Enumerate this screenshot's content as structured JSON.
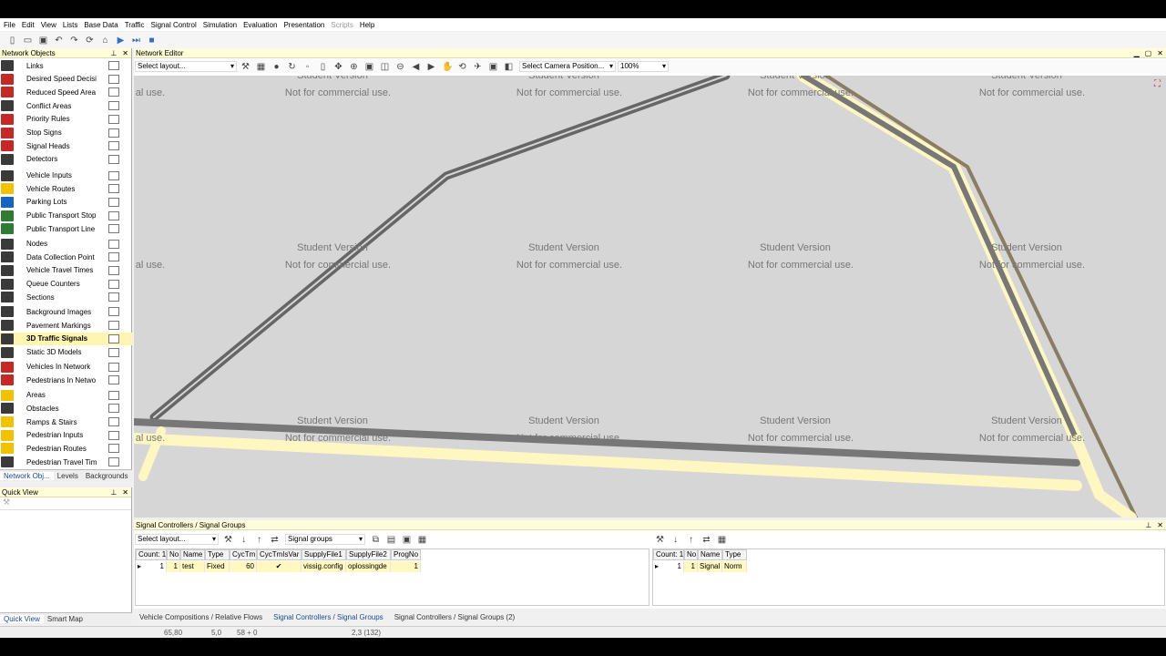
{
  "menu": [
    "File",
    "Edit",
    "View",
    "Lists",
    "Base Data",
    "Traffic",
    "Signal Control",
    "Simulation",
    "Evaluation",
    "Presentation",
    "Scripts",
    "Help"
  ],
  "network_objects": {
    "title": "Network Objects",
    "items": [
      {
        "label": "Links",
        "icon": "link-icon"
      },
      {
        "label": "Desired Speed Decisi",
        "icon": "speed-icon"
      },
      {
        "label": "Reduced Speed Area",
        "icon": "reduced-speed-icon"
      },
      {
        "label": "Conflict Areas",
        "icon": "conflict-icon"
      },
      {
        "label": "Priority Rules",
        "icon": "priority-icon"
      },
      {
        "label": "Stop Signs",
        "icon": "stop-icon"
      },
      {
        "label": "Signal Heads",
        "icon": "signal-head-icon"
      },
      {
        "label": "Detectors",
        "icon": "detector-icon"
      },
      {
        "label": "Vehicle Inputs",
        "icon": "vehicle-input-icon"
      },
      {
        "label": "Vehicle Routes",
        "icon": "route-icon"
      },
      {
        "label": "Parking Lots",
        "icon": "parking-icon"
      },
      {
        "label": "Public Transport Stop",
        "icon": "pt-stop-icon"
      },
      {
        "label": "Public Transport Line",
        "icon": "pt-line-icon"
      },
      {
        "label": "Nodes",
        "icon": "node-icon"
      },
      {
        "label": "Data Collection Point",
        "icon": "data-point-icon"
      },
      {
        "label": "Vehicle Travel Times",
        "icon": "travel-time-icon"
      },
      {
        "label": "Queue Counters",
        "icon": "queue-icon"
      },
      {
        "label": "Sections",
        "icon": "section-icon"
      },
      {
        "label": "Background Images",
        "icon": "image-icon"
      },
      {
        "label": "Pavement Markings",
        "icon": "marking-icon"
      },
      {
        "label": "3D Traffic Signals",
        "icon": "traffic-signal-3d-icon"
      },
      {
        "label": "Static 3D Models",
        "icon": "model-3d-icon"
      },
      {
        "label": "Vehicles In Network",
        "icon": "vehicle-icon"
      },
      {
        "label": "Pedestrians In Netwo",
        "icon": "pedestrian-icon"
      },
      {
        "label": "Areas",
        "icon": "area-icon"
      },
      {
        "label": "Obstacles",
        "icon": "obstacle-icon"
      },
      {
        "label": "Ramps & Stairs",
        "icon": "ramp-icon"
      },
      {
        "label": "Pedestrian Inputs",
        "icon": "ped-input-icon"
      },
      {
        "label": "Pedestrian Routes",
        "icon": "ped-route-icon"
      },
      {
        "label": "Pedestrian Travel Tim",
        "icon": "ped-time-icon"
      }
    ],
    "tabs": [
      "Network Obj...",
      "Levels",
      "Backgrounds"
    ]
  },
  "quick_view": {
    "title": "Quick View",
    "tabs": [
      "Quick View",
      "Smart Map"
    ]
  },
  "editor": {
    "title": "Network Editor",
    "layout_placeholder": "Select layout...",
    "camera_placeholder": "Select Camera Position...",
    "zoom": "100%",
    "watermark_1": "Student Version",
    "watermark_2": "Not for commercial use.",
    "watermark_partial": "al use."
  },
  "signal_groups": {
    "title": "Signal Controllers / Signal Groups",
    "layout_placeholder": "Select layout...",
    "relation": "Signal groups",
    "left_headers": [
      "Count: 1",
      "No",
      "Name",
      "Type",
      "CycTm",
      "CycTmIsVar",
      "SupplyFile1",
      "SupplyFile2",
      "ProgNo"
    ],
    "left_row": {
      "no": "1",
      "name": "test",
      "type": "Fixed",
      "cyctm": "60",
      "check": "✔",
      "supply1": "vissig.config",
      "supply2": "oplossingde",
      "progno": "1",
      "rownum": "1"
    },
    "right_headers": [
      "Count: 1",
      "No",
      "Name",
      "Type"
    ],
    "right_row": {
      "rownum": "1",
      "no": "1",
      "name": "Signal",
      "type": "Norm"
    }
  },
  "doc_tabs": [
    "Vehicle Compositions / Relative Flows",
    "Signal Controllers / Signal Groups",
    "Signal Controllers / Signal Groups (2)"
  ],
  "status": [
    "65,80",
    "5,0",
    "58 + 0",
    "2,3 (132)"
  ]
}
